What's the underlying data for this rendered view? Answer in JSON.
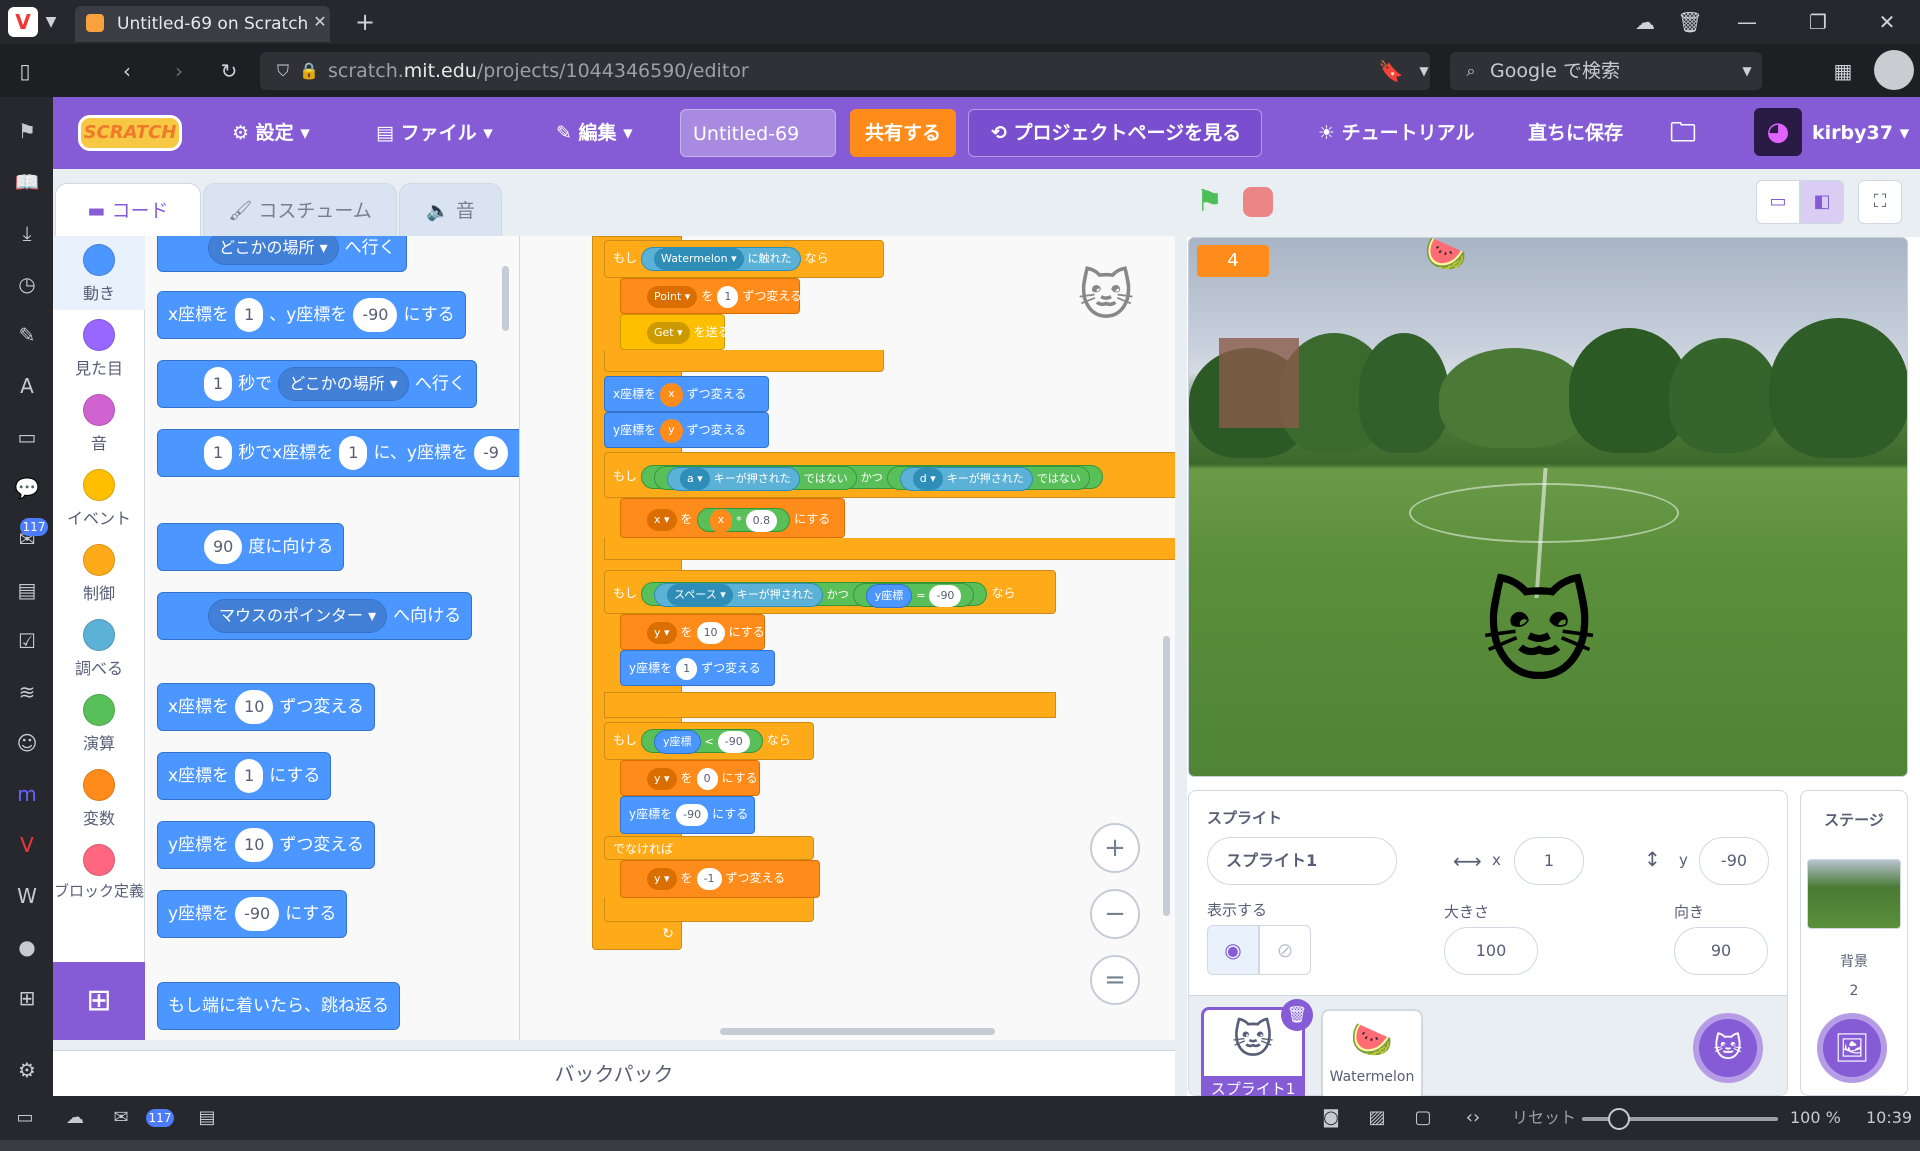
{
  "browser": {
    "tab_title": "Untitled-69 on Scratch",
    "url_prefix": "scratch.",
    "url_domain": "mit.edu",
    "url_path": "/projects/1044346590/editor",
    "search_placeholder": "Google で検索",
    "mail_badge": "117"
  },
  "menubar": {
    "logo": "SCRATCH",
    "settings": "設定",
    "file": "ファイル",
    "edit": "編集",
    "project_title": "Untitled-69",
    "share": "共有する",
    "project_page": "プロジェクトページを見る",
    "tutorial": "チュートリアル",
    "save_now": "直ちに保存",
    "username": "kirby37"
  },
  "tabs": {
    "code": "コード",
    "costume": "コスチューム",
    "sound": "音"
  },
  "categories": [
    {
      "label": "動き",
      "color": "#4c97ff"
    },
    {
      "label": "見た目",
      "color": "#9966ff"
    },
    {
      "label": "音",
      "color": "#cf63cf"
    },
    {
      "label": "イベント",
      "color": "#ffbf00"
    },
    {
      "label": "制御",
      "color": "#ffab19"
    },
    {
      "label": "調べる",
      "color": "#5cb1d6"
    },
    {
      "label": "演算",
      "color": "#59c059"
    },
    {
      "label": "変数",
      "color": "#ff8c1a"
    },
    {
      "label": "ブロック定義",
      "color": "#ff6680"
    }
  ],
  "palette": {
    "goto_random": "どこかの場所",
    "goto_suffix": "へ行く",
    "setxy_x_label": "x座標を",
    "setxy_x": "1",
    "setxy_y_label": "、y座標を",
    "setxy_y": "-90",
    "setxy_suffix": "にする",
    "glide_secs": "1",
    "glide_mid": "秒で",
    "glide_target": "どこかの場所",
    "glide_suffix": "へ行く",
    "glidexy_secs": "1",
    "glidexy_mid": "秒でx座標を",
    "glidexy_x": "1",
    "glidexy_mid2": "に、y座標を",
    "glidexy_y": "-9",
    "point_dir": "90",
    "point_suffix": "度に向ける",
    "point_towards": "マウスのポインター",
    "point_towards_suffix": "へ向ける",
    "changex_label": "x座標を",
    "changex_val": "10",
    "changex_suffix": "ずつ変える",
    "setx_label": "x座標を",
    "setx_val": "1",
    "setx_suffix": "にする",
    "changey_label": "y座標を",
    "changey_val": "10",
    "changey_suffix": "ずつ変える",
    "sety_label": "y座標を",
    "sety_val": "-90",
    "sety_suffix": "にする",
    "bounce": "もし端に着いたら、跳ね返る"
  },
  "script": {
    "if_word": "もし",
    "then_word": "なら",
    "touching_obj": "Watermelon",
    "touching_suffix": "に触れた",
    "change_var": "Point",
    "change_mid": "を",
    "change_val": "1",
    "change_suffix": "ずつ変える",
    "broadcast_msg": "Get",
    "broadcast_suffix": "を送る",
    "changex_label": "x座標を",
    "changex_var": "x",
    "changey_label": "y座標を",
    "changey_var": "y",
    "key_a": "a",
    "key_pressed": "キーが押された",
    "not_word": "ではない",
    "and_word": "かつ",
    "key_d": "d",
    "setvar_x": "x",
    "setvar_mid": "を",
    "mul_left": "x",
    "mul_op": "*",
    "mul_right": "0.8",
    "set_suffix": "にする",
    "key_space": "スペース",
    "ypos_reporter": "y座標",
    "eq_op": "=",
    "eq_val": "-90",
    "setvar_y": "y",
    "sety_val": "10",
    "changey_val": "1",
    "lt_op": "<",
    "lt_val": "-90",
    "sety0_val": "0",
    "setypos_val": "-90",
    "else_word": "でなければ",
    "changey_neg": "-1"
  },
  "zoom": {
    "in": "+",
    "out": "−",
    "reset": "="
  },
  "backpack": "バックパック",
  "stage": {
    "score": "4"
  },
  "sprite_info": {
    "header": "スプライト",
    "name": "スプライト1",
    "x_label": "x",
    "x": "1",
    "y_label": "y",
    "y": "-90",
    "show_label": "表示する",
    "size_label": "大きさ",
    "size": "100",
    "direction_label": "向き",
    "direction": "90"
  },
  "sprites": [
    {
      "name": "スプライト1"
    },
    {
      "name": "Watermelon"
    }
  ],
  "stage_pane": {
    "header": "ステージ",
    "backdrop_label": "背景",
    "backdrop_count": "2"
  },
  "statusbar": {
    "reset": "リセット",
    "zoom": "100 %",
    "time": "10:39",
    "mail_badge": "117"
  },
  "colors": {
    "accent": "#855cd6",
    "share": "#ff8c1a",
    "motion": "#4c97ff"
  }
}
